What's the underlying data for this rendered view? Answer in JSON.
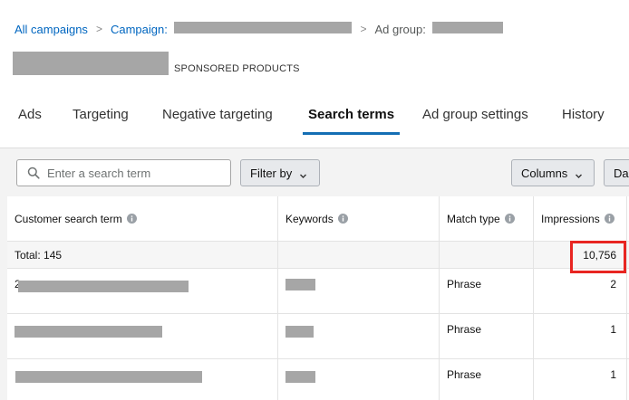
{
  "breadcrumb": {
    "all_campaigns": "All campaigns",
    "separator": ">",
    "campaign_label": "Campaign:",
    "ad_group_label": "Ad group:"
  },
  "header": {
    "badge": "SPONSORED PRODUCTS"
  },
  "tabs": [
    {
      "label": "Ads",
      "active": false
    },
    {
      "label": "Targeting",
      "active": false
    },
    {
      "label": "Negative targeting",
      "active": false
    },
    {
      "label": "Search terms",
      "active": true
    },
    {
      "label": "Ad group settings",
      "active": false
    },
    {
      "label": "History",
      "active": false
    }
  ],
  "toolbar": {
    "search_placeholder": "Enter a search term",
    "filter_label": "Filter by",
    "columns_label": "Columns",
    "date_label": "Da"
  },
  "table": {
    "columns": [
      "Customer search term",
      "Keywords",
      "Match type",
      "Impressions"
    ],
    "total_label": "Total: 145",
    "total_impressions": "10,756",
    "rows": [
      {
        "search_term_prefix": "2",
        "match_type": "Phrase",
        "impressions": "2"
      },
      {
        "search_term_prefix": "",
        "match_type": "Phrase",
        "impressions": "1"
      },
      {
        "search_term_prefix": "",
        "match_type": "Phrase",
        "impressions": "1"
      }
    ]
  },
  "colors": {
    "link": "#0066c0",
    "active_tab_underline": "#146eb4",
    "highlight": "#e82521",
    "redaction": "#a6a6a6"
  },
  "icons": [
    "search-icon",
    "chevron-down-icon",
    "info-icon"
  ]
}
